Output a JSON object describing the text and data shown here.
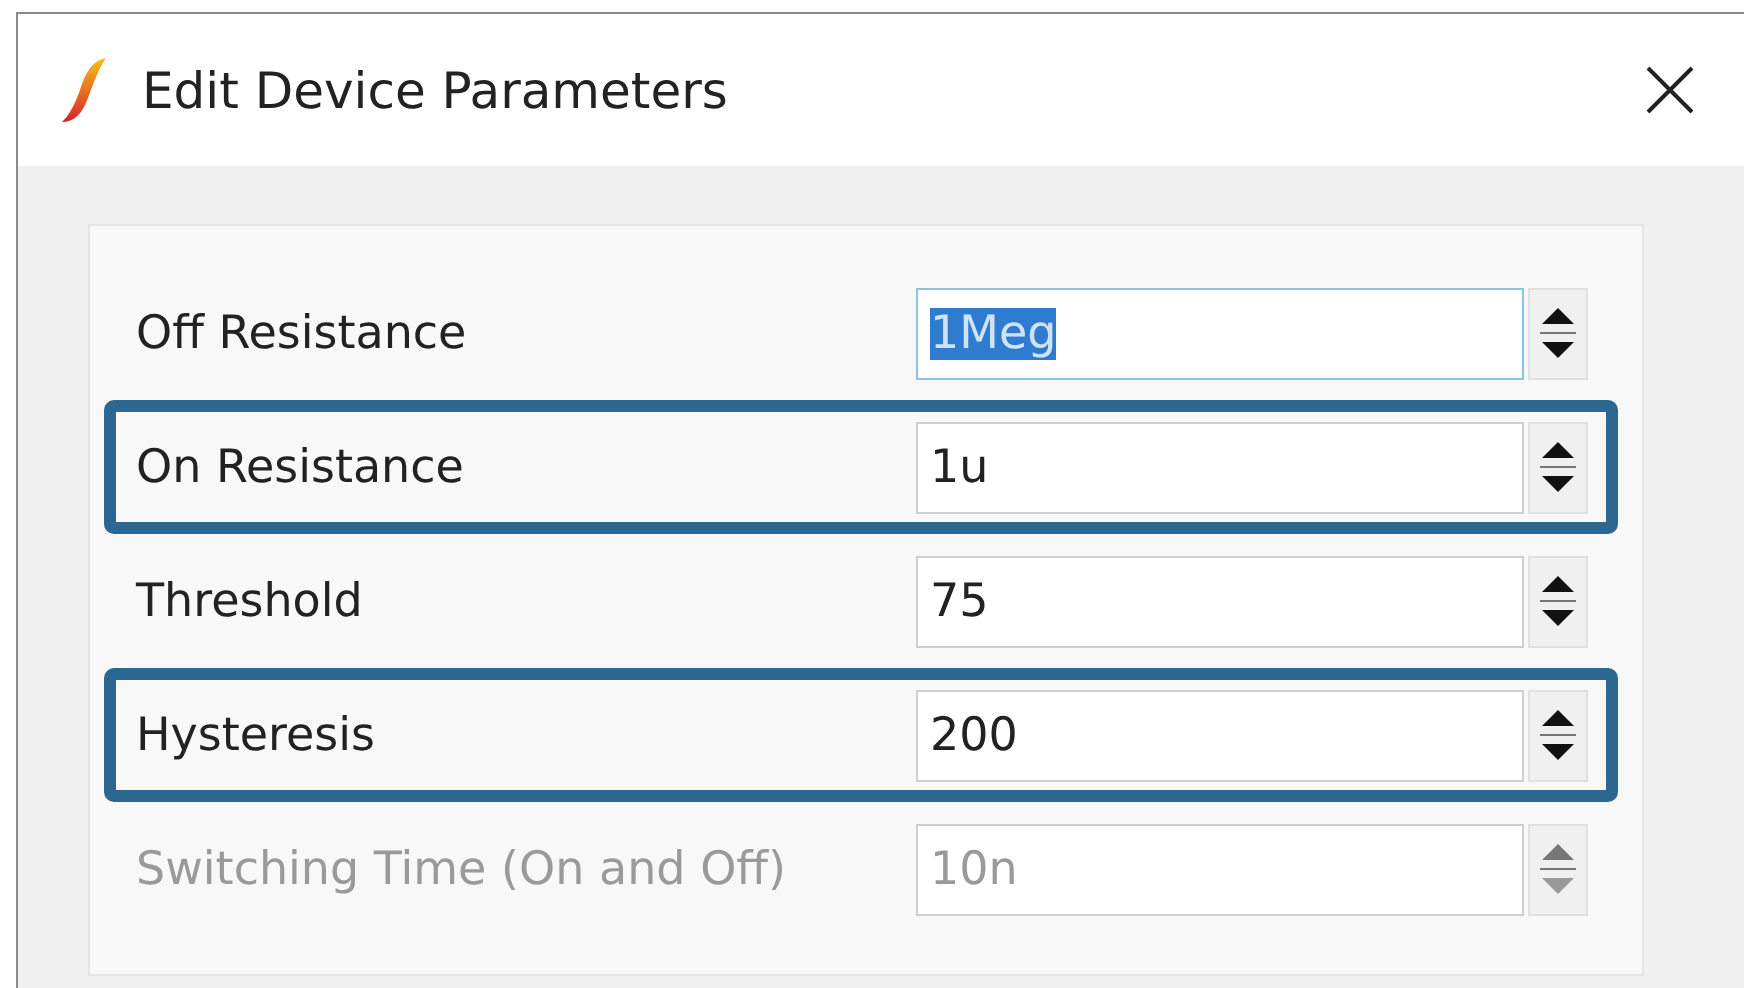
{
  "window": {
    "title": "Edit Device Parameters"
  },
  "parameters": [
    {
      "label": "Off Resistance",
      "value": "1Meg",
      "highlighted": false,
      "focused": true,
      "disabled": false
    },
    {
      "label": "On Resistance",
      "value": "1u",
      "highlighted": true,
      "focused": false,
      "disabled": false
    },
    {
      "label": "Threshold",
      "value": "75",
      "highlighted": false,
      "focused": false,
      "disabled": false
    },
    {
      "label": "Hysteresis",
      "value": "200",
      "highlighted": true,
      "focused": false,
      "disabled": false
    },
    {
      "label": "Switching Time (On and Off)",
      "value": "10n",
      "highlighted": false,
      "focused": false,
      "disabled": true
    }
  ]
}
